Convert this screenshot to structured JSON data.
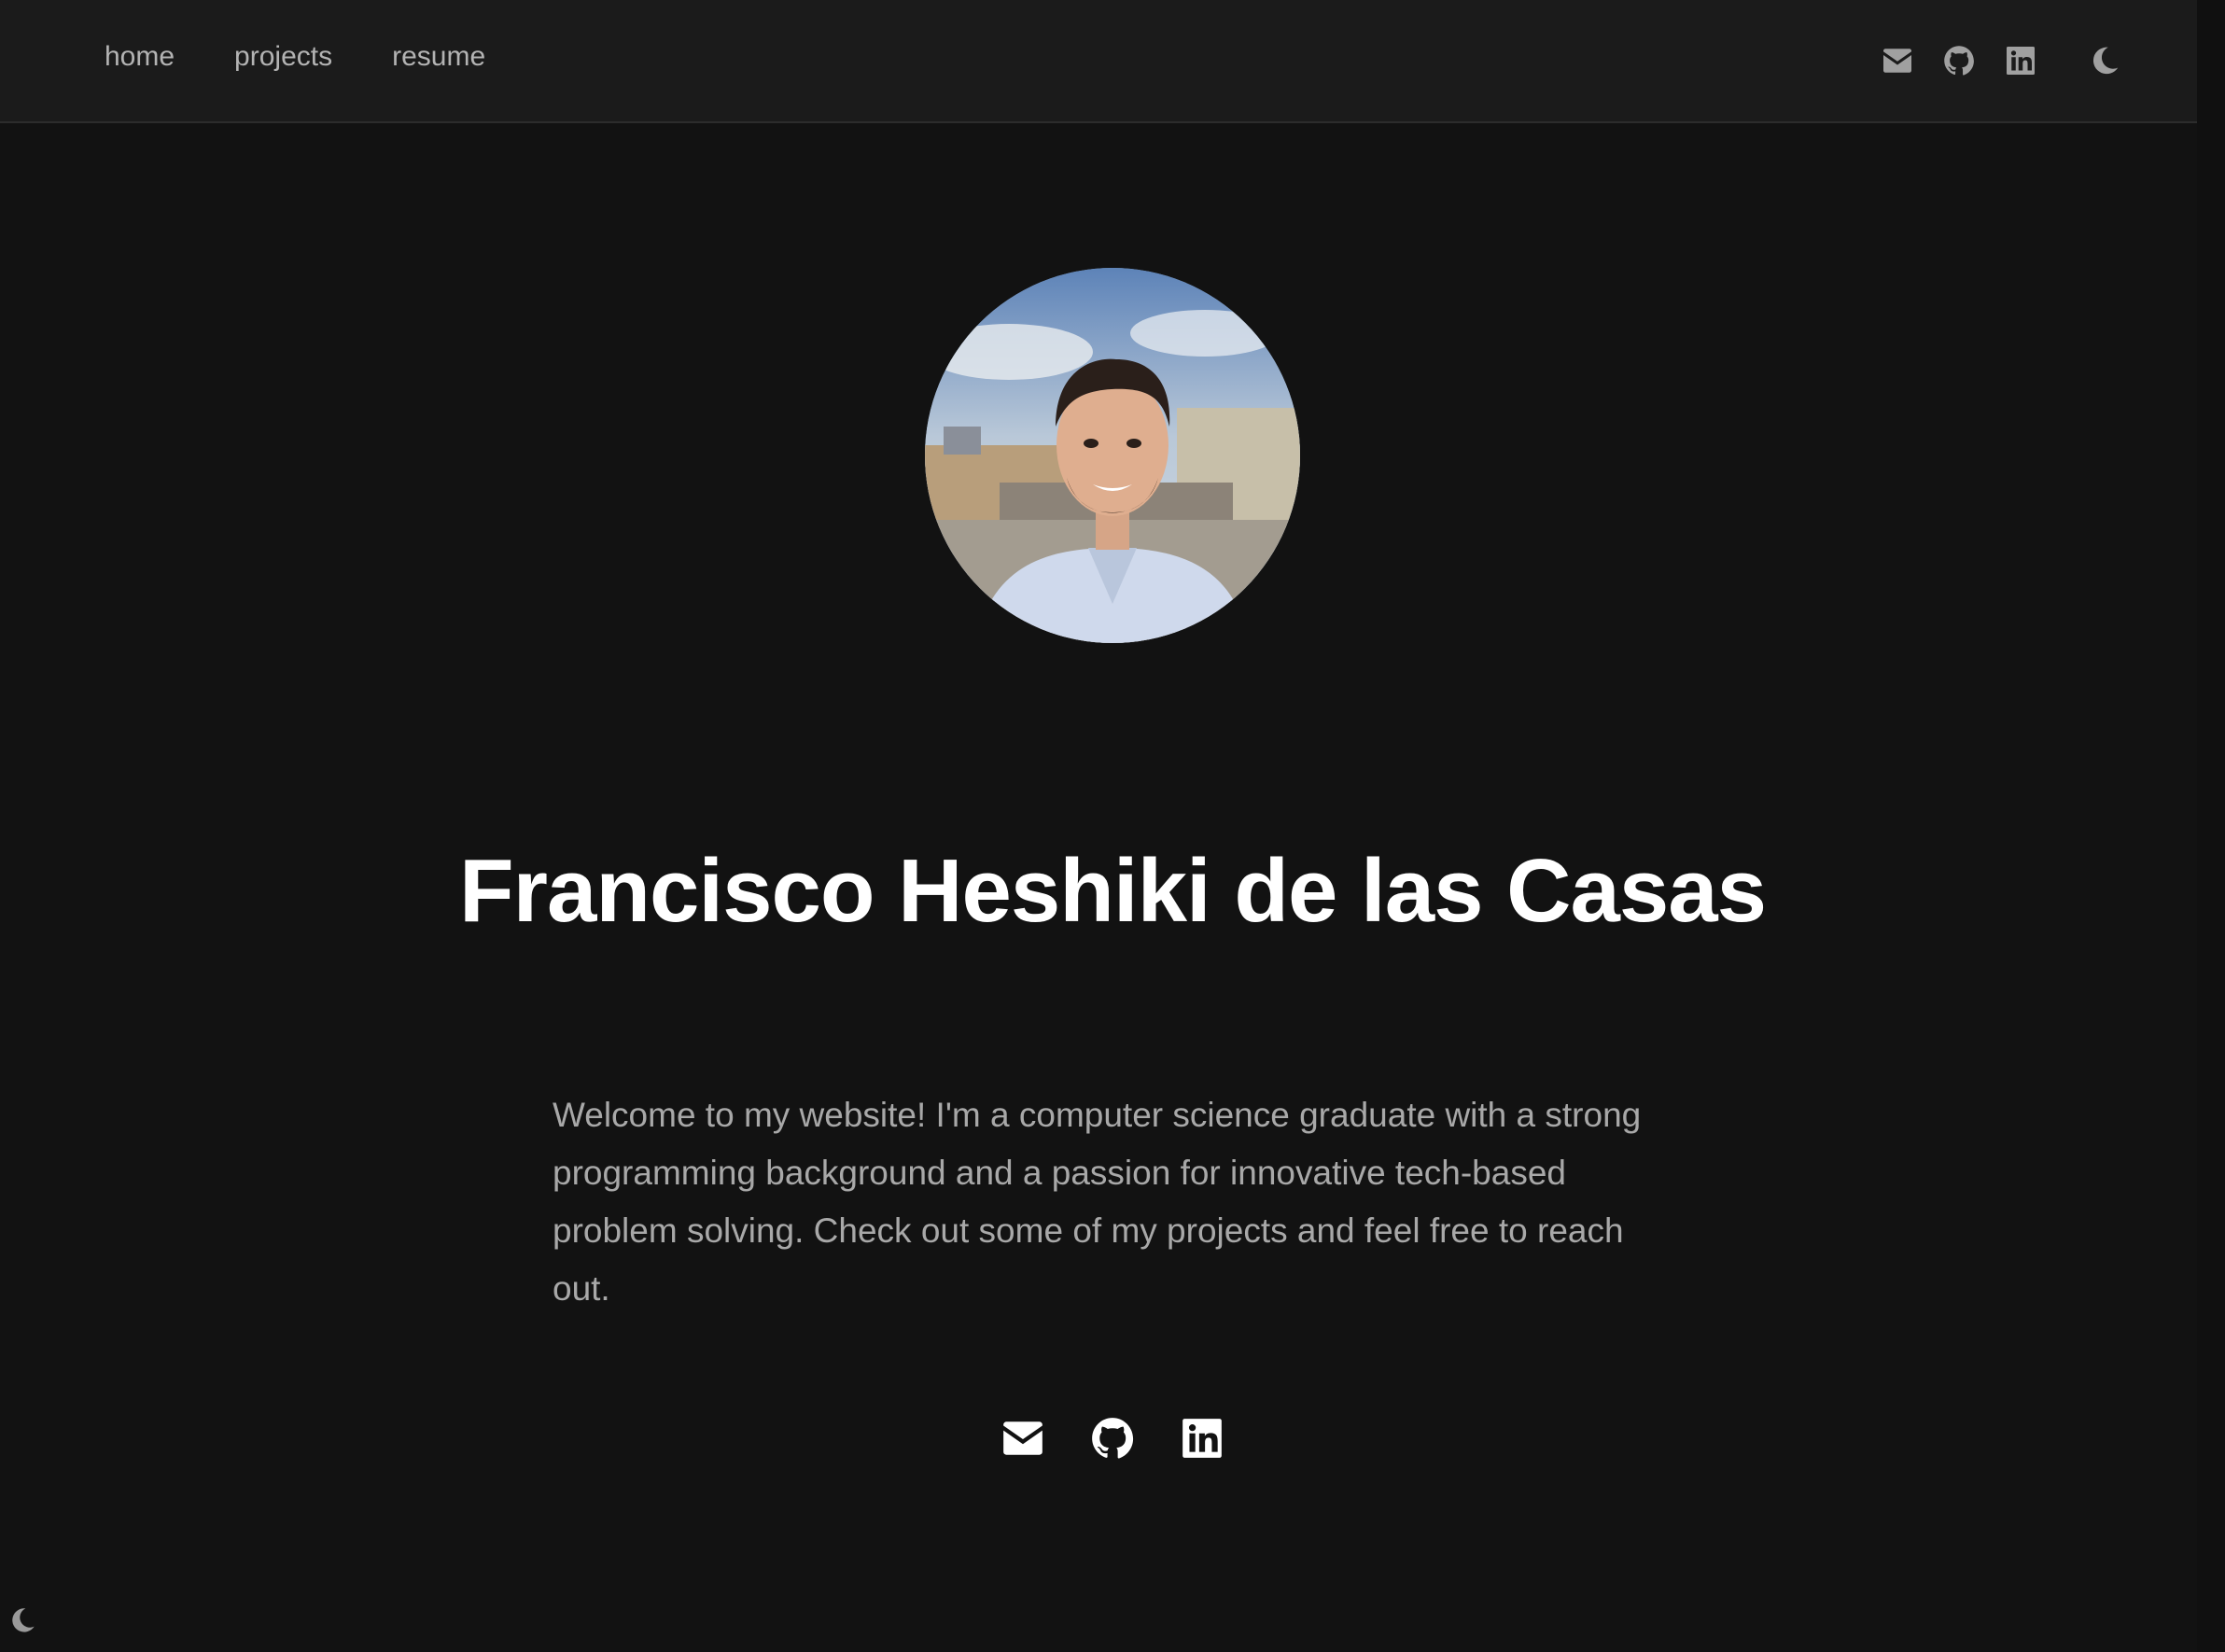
{
  "nav": {
    "links": [
      "home",
      "projects",
      "resume"
    ],
    "icons": [
      "envelope-icon",
      "github-icon",
      "linkedin-icon",
      "moon-icon"
    ]
  },
  "profile": {
    "photo": "profile-photo",
    "name": "Francisco Heshiki de las Casas",
    "bio": "Welcome to my website! I'm a computer science graduate with a strong programming background and a passion for innovative tech-based problem solving. Check out some of my projects and feel free to reach out."
  },
  "social": {
    "icons": [
      "envelope-icon",
      "github-icon",
      "linkedin-icon"
    ]
  },
  "theme_toggle": {
    "icon": "moon-icon"
  },
  "colors": {
    "background": "#121212",
    "navbar": "#1b1b1b",
    "nav_text": "#b3b3b3",
    "heading": "#ffffff",
    "body_text": "#a8a8a8",
    "nav_icon": "#a0a0a0",
    "social_icon": "#ffffff"
  }
}
